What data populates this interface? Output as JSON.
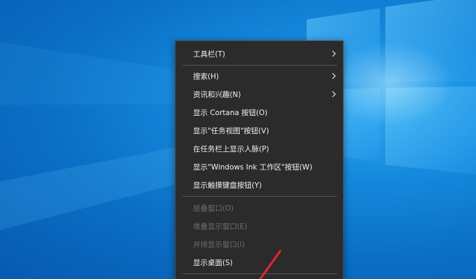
{
  "context_menu": {
    "items": [
      {
        "label": "工具栏(T)",
        "submenu": true,
        "disabled": false
      },
      {
        "label": "搜索(H)",
        "submenu": true,
        "disabled": false
      },
      {
        "label": "资讯和兴趣(N)",
        "submenu": true,
        "disabled": false
      },
      {
        "label": "显示 Cortana 按钮(O)",
        "submenu": false,
        "disabled": false
      },
      {
        "label": "显示\"任务视图\"按钮(V)",
        "submenu": false,
        "disabled": false
      },
      {
        "label": "在任务栏上显示人脉(P)",
        "submenu": false,
        "disabled": false
      },
      {
        "label": "显示\"Windows Ink 工作区\"按钮(W)",
        "submenu": false,
        "disabled": false
      },
      {
        "label": "显示触摸键盘按钮(Y)",
        "submenu": false,
        "disabled": false
      },
      {
        "label": "层叠窗口(D)",
        "submenu": false,
        "disabled": true
      },
      {
        "label": "堆叠显示窗口(E)",
        "submenu": false,
        "disabled": true
      },
      {
        "label": "并排显示窗口(I)",
        "submenu": false,
        "disabled": true
      },
      {
        "label": "显示桌面(S)",
        "submenu": false,
        "disabled": false
      }
    ]
  },
  "colors": {
    "menu_background": "#2b2b2b",
    "menu_text": "#f2f2f2",
    "menu_text_disabled": "#6e6e6e",
    "annotation_arrow": "#e8262b"
  }
}
